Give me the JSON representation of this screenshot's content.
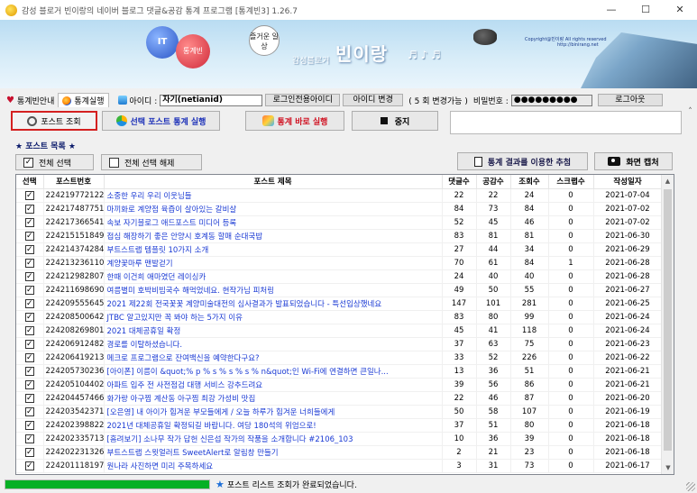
{
  "window": {
    "title": "감성 블로거 빈이랑의 네이버 블로그 댓글&공감 통계 프로그램 [통계빈3] 1.26.7",
    "controls": [
      "—",
      "☐",
      "✕"
    ]
  },
  "banner": {
    "it_label": "IT",
    "tongbin_label": "통계빈",
    "fun_label": "즐거운 일상",
    "brand": "빈이랑",
    "sub": "감성블로거",
    "notes": "♬ ♪ ♬",
    "copyright_1": "Copyright@빈이랑 All rights reserved",
    "copyright_2": "http://binirang.net"
  },
  "tabs": [
    {
      "label": "통계빈안내",
      "icon": "heart-icon"
    },
    {
      "label": "통계실행",
      "icon": "chart-circle-icon"
    }
  ],
  "account": {
    "id_label": "아이디 :",
    "id_value": "자기(netianid)",
    "login_used": "로그인전용아이디",
    "change_btn": "아이디 변경",
    "change_remaining": "( 5 회 변경가능 )",
    "pw_label": "비밀번호 :",
    "pw_value": "●●●●●●●●●",
    "logout": "로그아웃"
  },
  "toolbar": {
    "post_lookup": "포스트 조회",
    "selected_stats": "선택 포스트 통계 실행",
    "run_stats": "통계 바로 실행",
    "stop": "중지"
  },
  "list": {
    "header": "★ 포스트 목록 ★",
    "select_all": "전체 선택",
    "deselect_all": "전체 선택 해제",
    "stat_draw": "통계 결과를 이용한 추첨",
    "screenshot": "화면 캡처"
  },
  "columns": [
    "선택",
    "포스트번호",
    "포스트 제목",
    "댓글수",
    "공감수",
    "조회수",
    "스크랩수",
    "작성일자"
  ],
  "rows": [
    {
      "id": "224219772122",
      "title": "소중한 우리 우리 이웃님들",
      "c": "22",
      "l": "22",
      "v": "24",
      "s": "0",
      "d": "2021-07-04"
    },
    {
      "id": "224217487751",
      "title": "마끼화로 계양점 육즙이 살아있는 갈비살",
      "c": "84",
      "l": "73",
      "v": "84",
      "s": "0",
      "d": "2021-07-02"
    },
    {
      "id": "224217366541",
      "title": "속보 자기블로그 애드포스트 미디어 등록",
      "c": "52",
      "l": "45",
      "v": "46",
      "s": "0",
      "d": "2021-07-02"
    },
    {
      "id": "224215151849",
      "title": "접심 해장하기 좋은 안양시 호계동 할매 순대국밥",
      "c": "83",
      "l": "81",
      "v": "81",
      "s": "0",
      "d": "2021-06-30"
    },
    {
      "id": "224214374284",
      "title": "부트스트랩 템플릿 10가지 소개",
      "c": "27",
      "l": "44",
      "v": "34",
      "s": "0",
      "d": "2021-06-29"
    },
    {
      "id": "224213236110",
      "title": "계양꽃마루 맨발걷기",
      "c": "70",
      "l": "61",
      "v": "84",
      "s": "1",
      "d": "2021-06-28"
    },
    {
      "id": "224212982807",
      "title": "한때 이건희 애마였던 레이싱카",
      "c": "24",
      "l": "40",
      "v": "40",
      "s": "0",
      "d": "2021-06-28"
    },
    {
      "id": "224211698690",
      "title": "여름별미 호박비빔국수 해먹었네요. 현작가님 피처링",
      "c": "49",
      "l": "50",
      "v": "55",
      "s": "0",
      "d": "2021-06-27"
    },
    {
      "id": "224209555645",
      "title": "2021 제22회 전국꽃꽃 계양미술대전의 심사결과가 발표되었습니다 - 특선입상했네요",
      "c": "147",
      "l": "101",
      "v": "281",
      "s": "0",
      "d": "2021-06-25"
    },
    {
      "id": "224208500642",
      "title": "JTBC 알고있지만 꼭 봐야 하는 5가지 이유",
      "c": "83",
      "l": "80",
      "v": "99",
      "s": "0",
      "d": "2021-06-24"
    },
    {
      "id": "224208269801",
      "title": "2021 대체공휴일 확정",
      "c": "45",
      "l": "41",
      "v": "118",
      "s": "0",
      "d": "2021-06-24"
    },
    {
      "id": "224206912482",
      "title": "경로를 이탈하셨습니다.",
      "c": "37",
      "l": "63",
      "v": "75",
      "s": "0",
      "d": "2021-06-23"
    },
    {
      "id": "224206419213",
      "title": "메크로 프로그램으로 잔여백신을 예약한다구요?",
      "c": "33",
      "l": "52",
      "v": "226",
      "s": "0",
      "d": "2021-06-22"
    },
    {
      "id": "224205730236",
      "title": "[아이폰] 이름이 &quot;% p % s % s % s % n&quot;인 Wi-Fi에 연결하면 큰일나...",
      "c": "13",
      "l": "36",
      "v": "51",
      "s": "0",
      "d": "2021-06-21"
    },
    {
      "id": "224205104402",
      "title": "아파트 입주 전 사전점검 대행 서비스 강추드려요",
      "c": "39",
      "l": "56",
      "v": "86",
      "s": "0",
      "d": "2021-06-21"
    },
    {
      "id": "224204457466",
      "title": "화가랑 아구찜 계산동 아구찜 최강 가성비 맛집",
      "c": "22",
      "l": "46",
      "v": "87",
      "s": "0",
      "d": "2021-06-20"
    },
    {
      "id": "224203542371",
      "title": "[오은영] 내 아이가 힘겨운 부모들에게 / 오늘 하루가 힘겨운 너희들에게",
      "c": "50",
      "l": "58",
      "v": "107",
      "s": "0",
      "d": "2021-06-19"
    },
    {
      "id": "224202398822",
      "title": "2021년 대체공휴일 확정되길 바랍니다. 여당 180석의 위엄으로!",
      "c": "37",
      "l": "51",
      "v": "80",
      "s": "0",
      "d": "2021-06-18"
    },
    {
      "id": "224202335713",
      "title": "[흠려보기] 소나무 작가 답헌 신은섭 작가의 작품을 소개합니다 #2106_103",
      "c": "10",
      "l": "36",
      "v": "39",
      "s": "0",
      "d": "2021-06-18"
    },
    {
      "id": "224202231326",
      "title": "부트스트랩 스윗얼러트 SweetAlert로 알림창 만들기",
      "c": "2",
      "l": "21",
      "v": "23",
      "s": "0",
      "d": "2021-06-18"
    },
    {
      "id": "224201118197",
      "title": "원나라 사진하면 미리 주목하세요",
      "c": "3",
      "l": "31",
      "v": "73",
      "s": "0",
      "d": "2021-06-17"
    }
  ],
  "status": {
    "message": "포스트 리스트 조회가 완료되었습니다.",
    "progress": 1.0
  }
}
